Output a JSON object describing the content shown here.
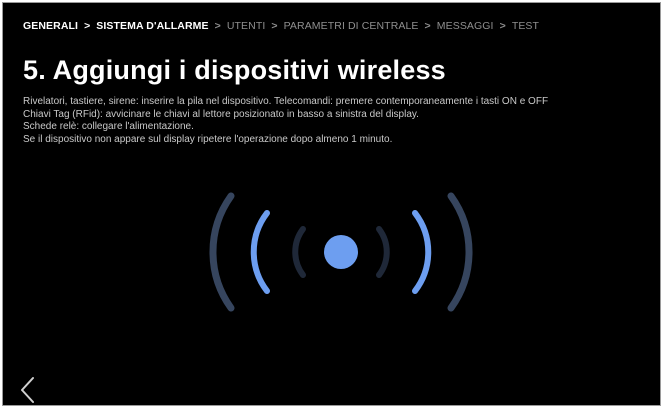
{
  "breadcrumb": [
    {
      "label": "GENERALI",
      "active": true
    },
    {
      "label": "SISTEMA D'ALLARME",
      "active": true
    },
    {
      "label": "UTENTI",
      "active": false
    },
    {
      "label": "PARAMETRI DI CENTRALE",
      "active": false
    },
    {
      "label": "MESSAGGI",
      "active": false
    },
    {
      "label": "TEST",
      "active": false
    }
  ],
  "breadcrumb_separator": ">",
  "page_title": "5. Aggiungi i dispositivi wireless",
  "instructions": [
    "Rivelatori, tastiere, sirene: inserire la pila nel dispositivo. Telecomandi: premere contemporaneamente i tasti ON e OFF",
    "Chiavi Tag (RFid): avvicinare le chiavi al lettore posizionato in basso a sinistra del display.",
    "Schede relè: collegare l'alimentazione.",
    "Se il dispositivo non appare sul display ripetere l'operazione dopo almeno 1 minuto."
  ],
  "icons": {
    "signal": "wireless-signal-icon",
    "back": "chevron-left-icon"
  },
  "colors": {
    "background": "#000000",
    "accent": "#6d9ef0",
    "outer_arc": "#36455e",
    "inner_arc": "#1f2838",
    "breadcrumb_active": "#ffffff",
    "breadcrumb_inactive": "#8f8f8f",
    "text": "#c9c9c9"
  }
}
